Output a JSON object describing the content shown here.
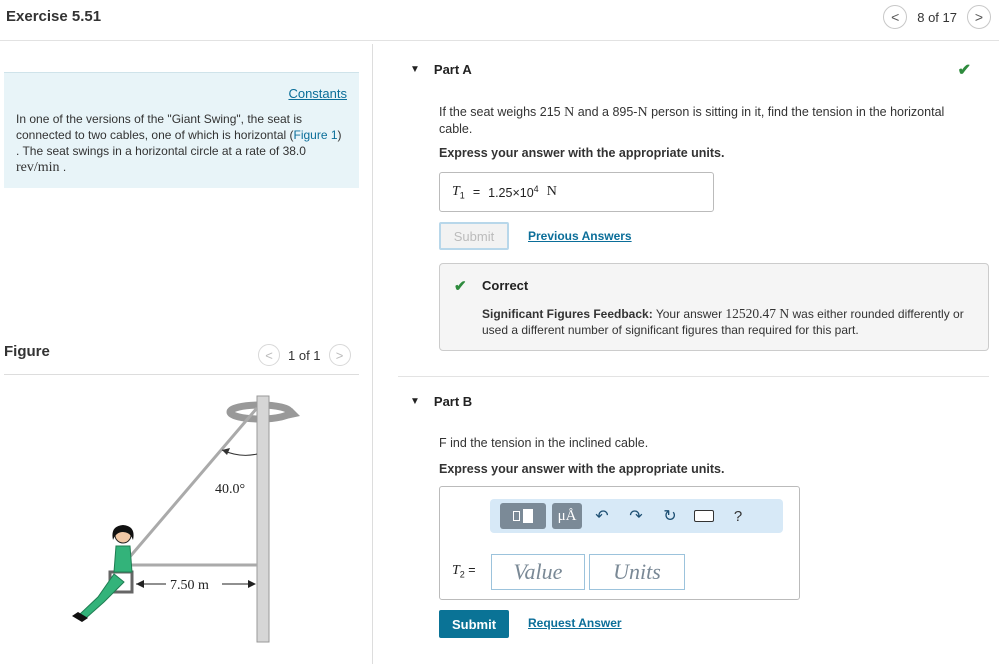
{
  "header": {
    "title": "Exercise 5.51",
    "pager_prev": "<",
    "pager_count": "8 of 17",
    "pager_next": ">"
  },
  "sidebar": {
    "constants_link": "Constants",
    "problem": {
      "text_1": "In one of the versions of the \"Giant Swing\", the seat is connected to two cables, one of which is horizontal (",
      "figure_link": "Figure 1",
      "text_2": ") . The seat swings in a horizontal circle at a rate of 38.0 ",
      "rate_unit": "rev/min",
      "text_3": " ."
    },
    "figure_label": "Figure",
    "figure_pager_prev": "<",
    "figure_pager_count": "1 of 1",
    "figure_pager_next": ">",
    "figure": {
      "angle_label": "40.0°",
      "distance_label": "7.50 m"
    }
  },
  "part_a": {
    "title": "Part A",
    "status_icon": "checkmark-icon",
    "question_1": "If the seat weighs 215 ",
    "question_unit_1": "N",
    "question_2": " and a 895-",
    "question_unit_2": "N",
    "question_3": " person is sitting in it, find the tension in the horizontal cable.",
    "instruction": "Express your answer with the appropriate units.",
    "answer": {
      "var_name": "T",
      "var_sub": "1",
      "equals": "=",
      "mantissa": "1.25×10",
      "exponent": "4",
      "unit": "N"
    },
    "submit_label": "Submit",
    "previous_answers_label": "Previous Answers",
    "feedback": {
      "status": "Correct",
      "label": "Significant Figures Feedback:",
      "text_1": " Your answer ",
      "value": "12520.47 N",
      "text_2": " was either rounded differently or used a different number of significant figures than required for this part."
    }
  },
  "part_b": {
    "title": "Part B",
    "question": "F ind the tension in the inclined cable.",
    "instruction": "Express your answer with the appropriate units.",
    "toolbar": {
      "templates_icon": "templates-icon",
      "units_button": "μÅ",
      "undo_icon": "undo-icon",
      "redo_icon": "redo-icon",
      "reset_icon": "reset-icon",
      "keyboard_icon": "keyboard-icon",
      "help_label": "?"
    },
    "var_name": "T",
    "var_sub": "2",
    "equals": "=",
    "value_placeholder": "Value",
    "units_placeholder": "Units",
    "submit_label": "Submit",
    "request_answer_label": "Request Answer"
  },
  "colors": {
    "accent": "#0a7396",
    "link": "#0b6e99",
    "success": "#2e8b3d",
    "constants_bg": "#e8f4f8",
    "toolbar_bg": "#d7e9f7"
  }
}
